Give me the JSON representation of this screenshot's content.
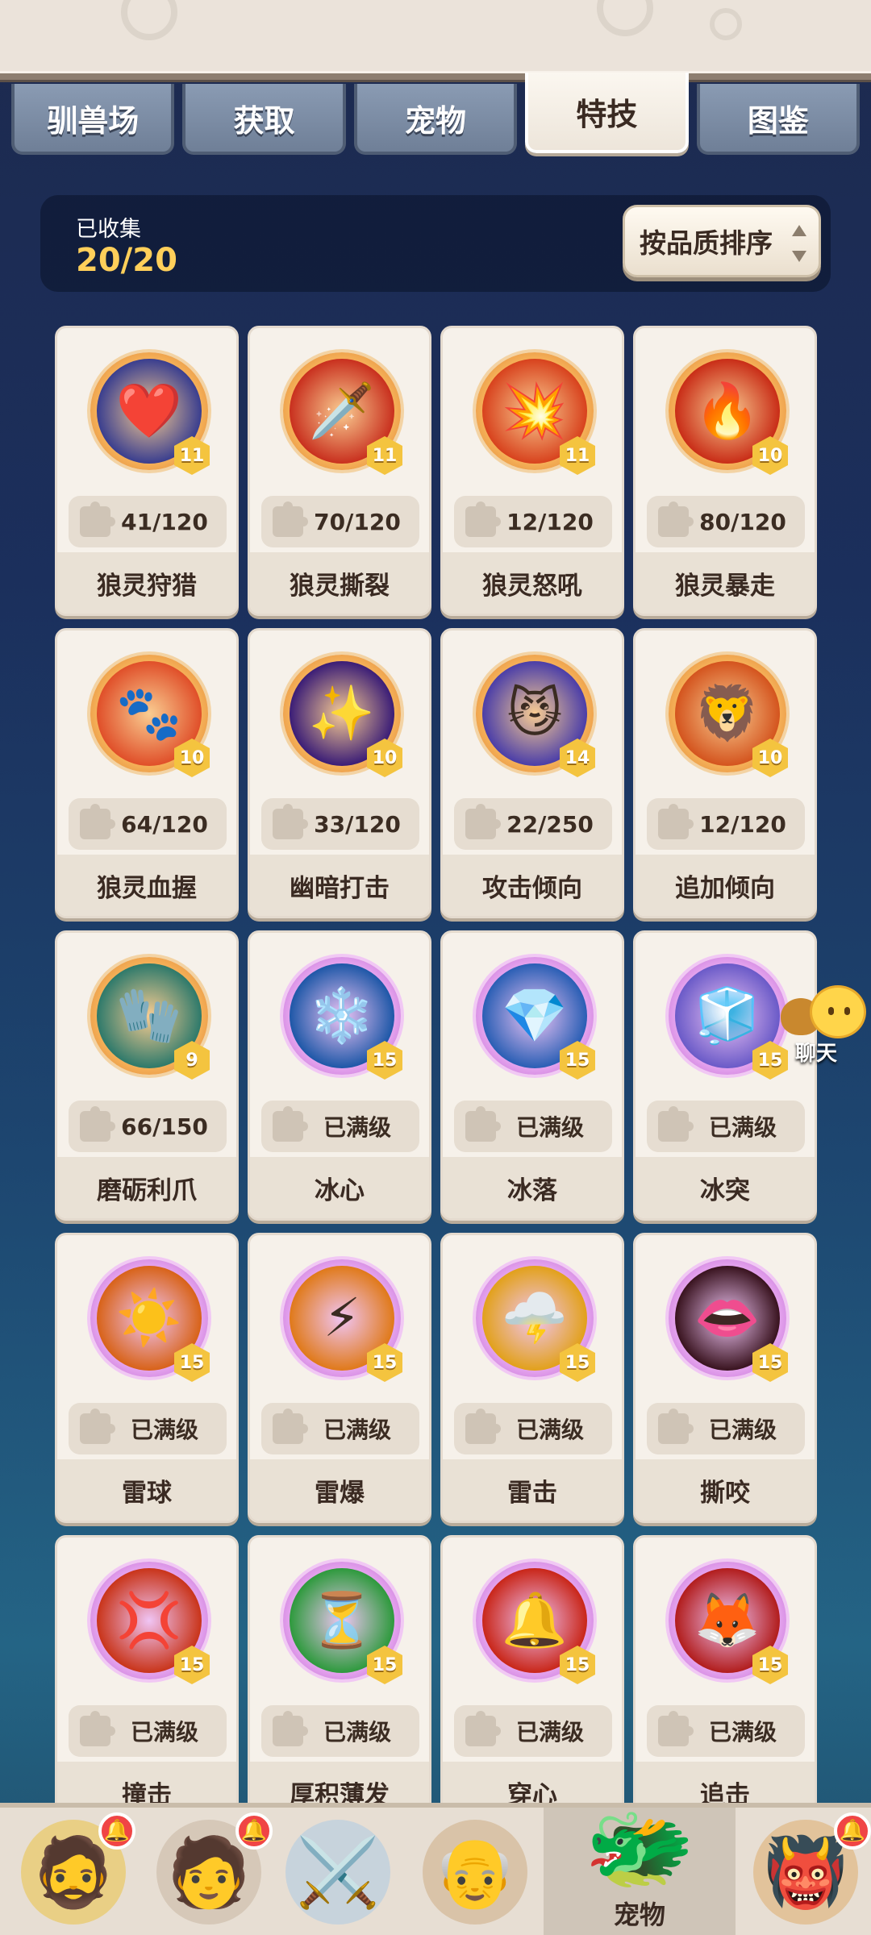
{
  "tabs": [
    {
      "label": "驯兽场",
      "active": false
    },
    {
      "label": "获取",
      "active": false
    },
    {
      "label": "宠物",
      "active": false
    },
    {
      "label": "特技",
      "active": true
    },
    {
      "label": "图鉴",
      "active": false
    }
  ],
  "collection": {
    "label": "已收集",
    "count": "20/20"
  },
  "sort": {
    "label": "按品质排序"
  },
  "skills": [
    {
      "name": "狼灵狩猎",
      "level": "11",
      "progress": "41/120",
      "icon": "❤️",
      "ring": "orange",
      "bg": "#3b3f8f"
    },
    {
      "name": "狼灵撕裂",
      "level": "11",
      "progress": "70/120",
      "icon": "🗡️",
      "ring": "orange",
      "bg": "#c9311f"
    },
    {
      "name": "狼灵怒吼",
      "level": "11",
      "progress": "12/120",
      "icon": "💥",
      "ring": "orange",
      "bg": "#d8431e"
    },
    {
      "name": "狼灵暴走",
      "level": "10",
      "progress": "80/120",
      "icon": "🔥",
      "ring": "orange",
      "bg": "#c92e18"
    },
    {
      "name": "狼灵血握",
      "level": "10",
      "progress": "64/120",
      "icon": "🐾",
      "ring": "orange",
      "bg": "#e0502a"
    },
    {
      "name": "幽暗打击",
      "level": "10",
      "progress": "33/120",
      "icon": "✨",
      "ring": "orange",
      "bg": "#3c1e77"
    },
    {
      "name": "攻击倾向",
      "level": "14",
      "progress": "22/250",
      "icon": "😼",
      "ring": "orange",
      "bg": "#4c3fa8"
    },
    {
      "name": "追加倾向",
      "level": "10",
      "progress": "12/120",
      "icon": "🦁",
      "ring": "orange",
      "bg": "#d4551f"
    },
    {
      "name": "磨砺利爪",
      "level": "9",
      "progress": "66/150",
      "icon": "🧤",
      "ring": "orange",
      "bg": "#2f7a6b"
    },
    {
      "name": "冰心",
      "level": "15",
      "progress": "已满级",
      "icon": "❄️",
      "ring": "purple",
      "bg": "#1f58a8"
    },
    {
      "name": "冰落",
      "level": "15",
      "progress": "已满级",
      "icon": "💎",
      "ring": "purple",
      "bg": "#2b5fb5"
    },
    {
      "name": "冰突",
      "level": "15",
      "progress": "已满级",
      "icon": "🧊",
      "ring": "purple",
      "bg": "#6b5bc8"
    },
    {
      "name": "雷球",
      "level": "15",
      "progress": "已满级",
      "icon": "☀️",
      "ring": "purple",
      "bg": "#d8631a"
    },
    {
      "name": "雷爆",
      "level": "15",
      "progress": "已满级",
      "icon": "⚡",
      "ring": "purple",
      "bg": "#e07a1b"
    },
    {
      "name": "雷击",
      "level": "15",
      "progress": "已满级",
      "icon": "🌩️",
      "ring": "purple",
      "bg": "#e2a11c"
    },
    {
      "name": "撕咬",
      "level": "15",
      "progress": "已满级",
      "icon": "👄",
      "ring": "purple",
      "bg": "#3a1420"
    },
    {
      "name": "撞击",
      "level": "15",
      "progress": "已满级",
      "icon": "💢",
      "ring": "purple",
      "bg": "#c9351b"
    },
    {
      "name": "厚积薄发",
      "level": "15",
      "progress": "已满级",
      "icon": "⏳",
      "ring": "purple",
      "bg": "#2f9a3e"
    },
    {
      "name": "穿心",
      "level": "15",
      "progress": "已满级",
      "icon": "🔔",
      "ring": "purple",
      "bg": "#c9271a"
    },
    {
      "name": "追击",
      "level": "15",
      "progress": "已满级",
      "icon": "🦊",
      "ring": "purple",
      "bg": "#b21e1e"
    }
  ],
  "chat": {
    "label": "聊天",
    "icon": "chat-bubble-icon"
  },
  "bottom_nav": {
    "active_label": "宠物",
    "items": [
      {
        "icon": "caveman-avatar-icon",
        "glyph": "🧔",
        "badge": true
      },
      {
        "icon": "warrior-avatar-icon",
        "glyph": "🧑",
        "badge": true
      },
      {
        "icon": "sword-shield-icon",
        "glyph": "⚔️",
        "badge": false
      },
      {
        "icon": "elder-avatar-icon",
        "glyph": "👴",
        "badge": false
      },
      {
        "icon": "pet-dragon-icon",
        "glyph": "🐲",
        "badge": false
      },
      {
        "icon": "tribe-chief-icon",
        "glyph": "👹",
        "badge": true
      }
    ]
  }
}
